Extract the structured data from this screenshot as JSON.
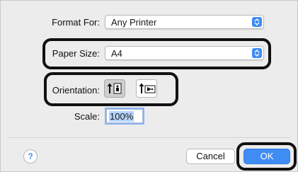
{
  "format_for": {
    "label": "Format For:",
    "value": "Any Printer"
  },
  "paper_size": {
    "label": "Paper Size:",
    "value": "A4"
  },
  "orientation": {
    "label": "Orientation:",
    "options": [
      {
        "icon": "portrait-orientation-icon",
        "selected": true
      },
      {
        "icon": "landscape-orientation-icon",
        "selected": false
      }
    ]
  },
  "scale": {
    "label": "Scale:",
    "value": "100%"
  },
  "help": {
    "label": "?"
  },
  "buttons": {
    "cancel": "Cancel",
    "ok": "OK"
  },
  "colors": {
    "accent": "#3f8cf5",
    "highlight_border": "#111111",
    "dialog_bg": "#ececec"
  }
}
